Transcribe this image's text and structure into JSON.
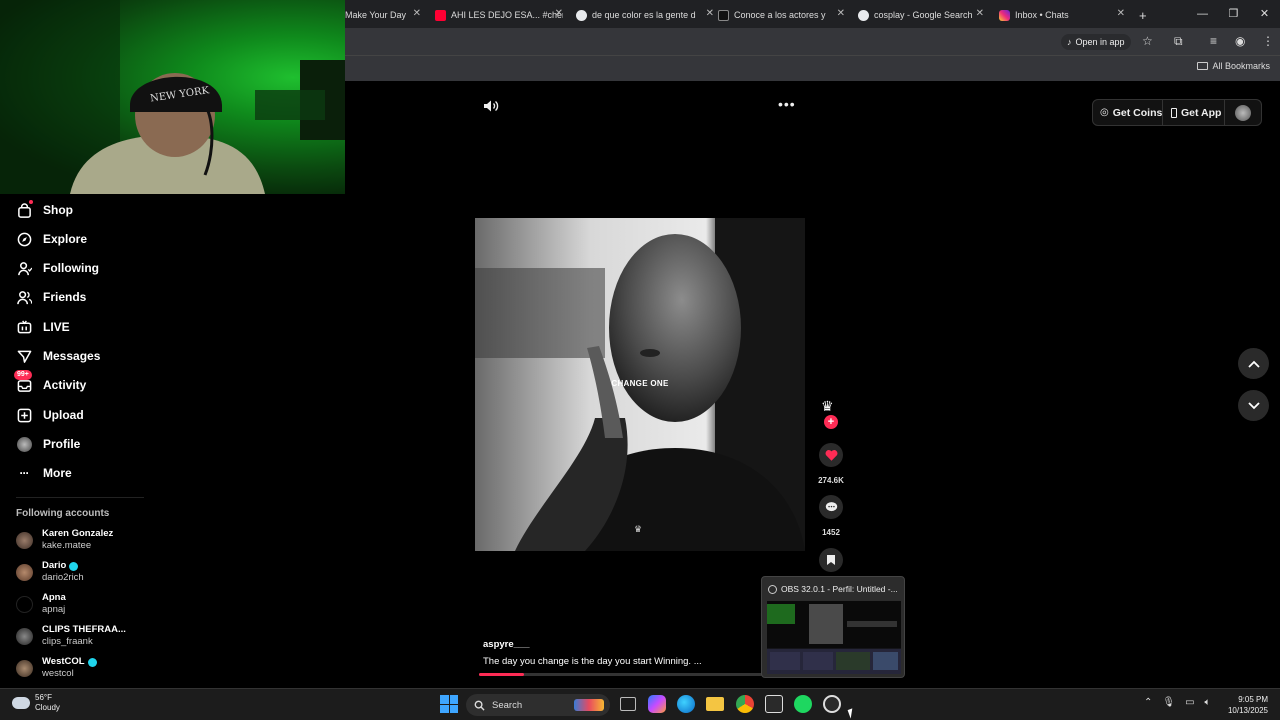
{
  "browser": {
    "tabs": [
      {
        "title": "Make Your Day",
        "favicon_color": "#202124"
      },
      {
        "title": "AHI LES DEJO ESA... #cher",
        "favicon_color": "#ff0033"
      },
      {
        "title": "de que color es la gente d",
        "favicon_color": "#e8eaed"
      },
      {
        "title": "Conoce a los actores y act",
        "favicon_color": "#111111"
      },
      {
        "title": "cosplay - Google Search",
        "favicon_color": "#e8eaed"
      },
      {
        "title": "Inbox • Chats",
        "favicon_color": "#d62976"
      }
    ],
    "new_tab": "+",
    "open_in_app_label": "Open in app",
    "all_bookmarks_label": "All Bookmarks"
  },
  "sidebar": {
    "items": [
      {
        "label": "Shop",
        "icon": "shop-bag-icon"
      },
      {
        "label": "Explore",
        "icon": "compass-icon"
      },
      {
        "label": "Following",
        "icon": "user-follow-icon"
      },
      {
        "label": "Friends",
        "icon": "friends-icon"
      },
      {
        "label": "LIVE",
        "icon": "live-tv-icon"
      },
      {
        "label": "Messages",
        "icon": "paper-plane-icon"
      },
      {
        "label": "Activity",
        "icon": "inbox-icon",
        "badge": "99+"
      },
      {
        "label": "Upload",
        "icon": "plus-square-icon"
      },
      {
        "label": "Profile",
        "icon": "avatar-icon"
      },
      {
        "label": "More",
        "icon": "more-dots-icon"
      }
    ],
    "following_title": "Following accounts",
    "accounts": [
      {
        "name": "Karen Gonzalez",
        "username": "kake.matee",
        "verified": false
      },
      {
        "name": "Dario",
        "username": "dario2rich",
        "verified": true
      },
      {
        "name": "Apna",
        "username": "apnaj",
        "verified": false
      },
      {
        "name": "CLIPS THEFRAA...",
        "username": "clips_fraank",
        "verified": false
      },
      {
        "name": "WestCOL",
        "username": "westcol",
        "verified": true
      }
    ]
  },
  "header": {
    "get_coins_label": "Get Coins",
    "get_app_label": "Get App"
  },
  "video": {
    "overlay_text": "CHANGE ONE",
    "likes": "274.6K",
    "comments": "1452",
    "author": "aspyre___",
    "description": "The day you change is the day you start Winning.  ...",
    "progress": 0.16
  },
  "obs_popup": {
    "title": "OBS 32.0.1 - Perfil: Untitled -..."
  },
  "taskbar": {
    "weather_temp": "56°F",
    "weather_desc": "Cloudy",
    "search_label": "Search",
    "time": "9:05 PM",
    "date": "10/13/2025"
  },
  "colors": {
    "accent": "#fe2c55",
    "background": "#000000",
    "browser_chrome": "#35363a",
    "tab_strip": "#202124"
  }
}
